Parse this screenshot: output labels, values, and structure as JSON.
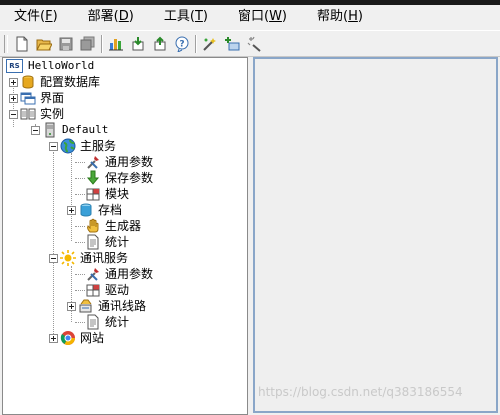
{
  "menu": [
    {
      "label": "文件",
      "key": "F"
    },
    {
      "label": "部署",
      "key": "D"
    },
    {
      "label": "工具",
      "key": "T"
    },
    {
      "label": "窗口",
      "key": "W"
    },
    {
      "label": "帮助",
      "key": "H"
    }
  ],
  "toolbar": {
    "buttons": [
      "new-file-icon",
      "open-folder-icon",
      "save-icon",
      "save-all-icon",
      "bar-chart-icon",
      "import-icon",
      "export-icon",
      "help-icon",
      "wand-icon",
      "add-device-icon",
      "magic-icon"
    ]
  },
  "tree": {
    "root": {
      "badge": "RS",
      "label": "HelloWorld"
    },
    "config_db": "配置数据库",
    "ui": "界面",
    "instance": "实例",
    "default": "Default",
    "main_service": "主服务",
    "ms_general": "通用参数",
    "ms_save": "保存参数",
    "ms_module": "模块",
    "ms_archive": "存档",
    "ms_generator": "生成器",
    "ms_stats": "统计",
    "comm_service": "通讯服务",
    "cs_general": "通用参数",
    "cs_driver": "驱动",
    "cs_lines": "通讯线路",
    "cs_stats": "统计",
    "website": "网站"
  },
  "watermark": "https://blog.csdn.net/q383186554"
}
